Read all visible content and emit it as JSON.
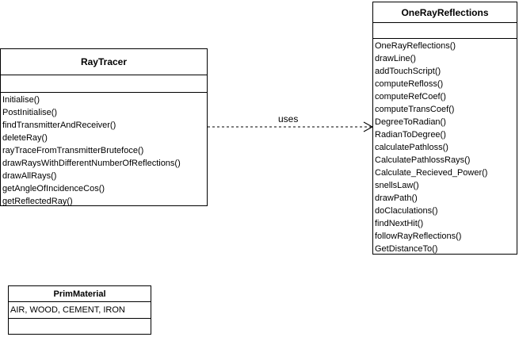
{
  "classes": {
    "raytracer": {
      "name": "RayTracer",
      "methods": [
        "Initialise()",
        "PostInitialise()",
        "findTransmitterAndReceiver()",
        "deleteRay()",
        "rayTraceFromTransmitterBrutefoce()",
        "drawRaysWithDifferentNumberOfReflections()",
        "drawAllRays()",
        "getAngleOfIncidenceCos()",
        "getReflectedRay()"
      ]
    },
    "onerayreflections": {
      "name": "OneRayReflections",
      "methods": [
        "OneRayReflections()",
        "drawLine()",
        "addTouchScript()",
        "computeRefloss()",
        "computeRefCoef()",
        "computeTransCoef()",
        "DegreeToRadian()",
        "RadianToDegree()",
        "calculatePathloss()",
        "CalculatePathlossRays()",
        "Calculate_Recieved_Power()",
        "snellsLaw()",
        "drawPath()",
        "doClaculations()",
        "findNextHit()",
        "followRayReflections()",
        "GetDistanceTo()"
      ]
    },
    "primmaterial": {
      "name": "PrimMaterial",
      "attributes": "AIR, WOOD, CEMENT, IRON"
    }
  },
  "relationship": {
    "label": "uses"
  }
}
